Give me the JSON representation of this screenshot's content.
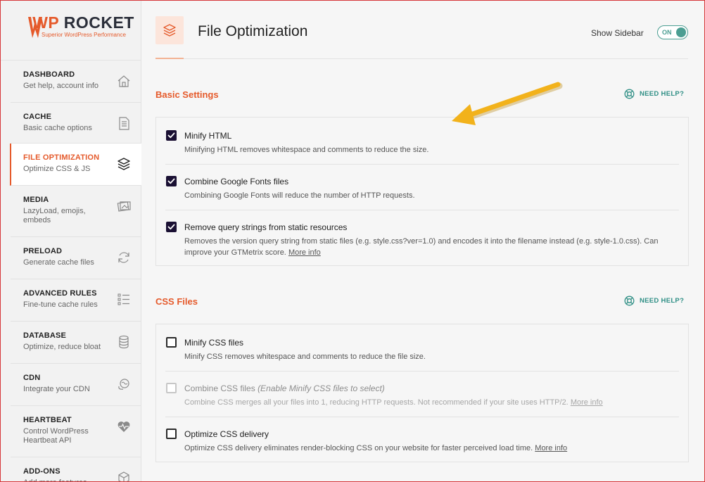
{
  "brand": {
    "name_part1": "WP",
    "name_part2": "ROCKET",
    "tagline": "Superior WordPress Performance",
    "accent_color": "#e55a2b"
  },
  "nav": [
    {
      "title": "DASHBOARD",
      "desc": "Get help, account info",
      "icon": "home-icon",
      "active": false
    },
    {
      "title": "CACHE",
      "desc": "Basic cache options",
      "icon": "document-icon",
      "active": false
    },
    {
      "title": "FILE OPTIMIZATION",
      "desc": "Optimize CSS & JS",
      "icon": "layers-icon",
      "active": true
    },
    {
      "title": "MEDIA",
      "desc": "LazyLoad, emojis, embeds",
      "icon": "images-icon",
      "active": false
    },
    {
      "title": "PRELOAD",
      "desc": "Generate cache files",
      "icon": "refresh-icon",
      "active": false
    },
    {
      "title": "ADVANCED RULES",
      "desc": "Fine-tune cache rules",
      "icon": "list-icon",
      "active": false
    },
    {
      "title": "DATABASE",
      "desc": "Optimize, reduce bloat",
      "icon": "database-icon",
      "active": false
    },
    {
      "title": "CDN",
      "desc": "Integrate your CDN",
      "icon": "globe-icon",
      "active": false
    },
    {
      "title": "HEARTBEAT",
      "desc": "Control WordPress Heartbeat API",
      "icon": "heart-pulse-icon",
      "active": false
    },
    {
      "title": "ADD-ONS",
      "desc": "Add more features",
      "icon": "addons-icon",
      "active": false
    }
  ],
  "header": {
    "title": "File Optimization",
    "show_sidebar_label": "Show Sidebar",
    "toggle_state": "ON"
  },
  "help_label": "NEED HELP?",
  "sections": [
    {
      "title": "Basic Settings",
      "options": [
        {
          "label": "Minify HTML",
          "note": "",
          "desc": "Minifying HTML removes whitespace and comments to reduce the size.",
          "link": "",
          "state": "checked"
        },
        {
          "label": "Combine Google Fonts files",
          "note": "",
          "desc": "Combining Google Fonts will reduce the number of HTTP requests.",
          "link": "",
          "state": "checked"
        },
        {
          "label": "Remove query strings from static resources",
          "note": "",
          "desc": "Removes the version query string from static files (e.g. style.css?ver=1.0) and encodes it into the filename instead (e.g. style-1.0.css). Can improve your GTMetrix score.",
          "link": "More info",
          "state": "checked"
        }
      ]
    },
    {
      "title": "CSS Files",
      "options": [
        {
          "label": "Minify CSS files",
          "note": "",
          "desc": "Minify CSS removes whitespace and comments to reduce the file size.",
          "link": "",
          "state": "unchecked"
        },
        {
          "label": "Combine CSS files",
          "note": "(Enable Minify CSS files to select)",
          "desc": "Combine CSS merges all your files into 1, reducing HTTP requests. Not recommended if your site uses HTTP/2.",
          "link": "More info",
          "state": "disabled"
        },
        {
          "label": "Optimize CSS delivery",
          "note": "",
          "desc": "Optimize CSS delivery eliminates render-blocking CSS on your website for faster perceived load time.",
          "link": "More info",
          "state": "unchecked"
        }
      ]
    }
  ],
  "colors": {
    "accent": "#e55a2b",
    "teal": "#2f8f85",
    "checkbox_checked": "#1a1033",
    "arrow": "#f2b21b"
  }
}
